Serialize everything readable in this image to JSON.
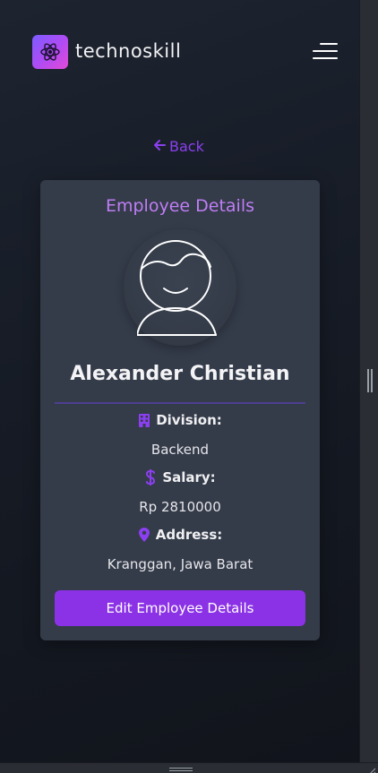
{
  "header": {
    "brand": "technoskill",
    "logo_icon": "atom-logo-icon",
    "menu_icon": "hamburger-menu-icon"
  },
  "back_link": {
    "label": "Back",
    "icon": "arrow-left-icon"
  },
  "employee_card": {
    "title": "Employee Details",
    "avatar_icon": "user-avatar-icon",
    "name": "Alexander Christian",
    "fields": [
      {
        "label": "Division:",
        "value": "Backend",
        "icon": "building-icon"
      },
      {
        "label": "Salary:",
        "value": "Rp 2810000",
        "icon": "dollar-icon"
      },
      {
        "label": "Address:",
        "value": "Kranggan, Jawa Barat",
        "icon": "map-pin-icon"
      }
    ],
    "edit_button": "Edit Employee Details"
  },
  "colors": {
    "accent": "#8b32e6",
    "title_accent": "#bf7ef5",
    "card_bg": "#343b49",
    "page_bg": "#1a1f29"
  }
}
